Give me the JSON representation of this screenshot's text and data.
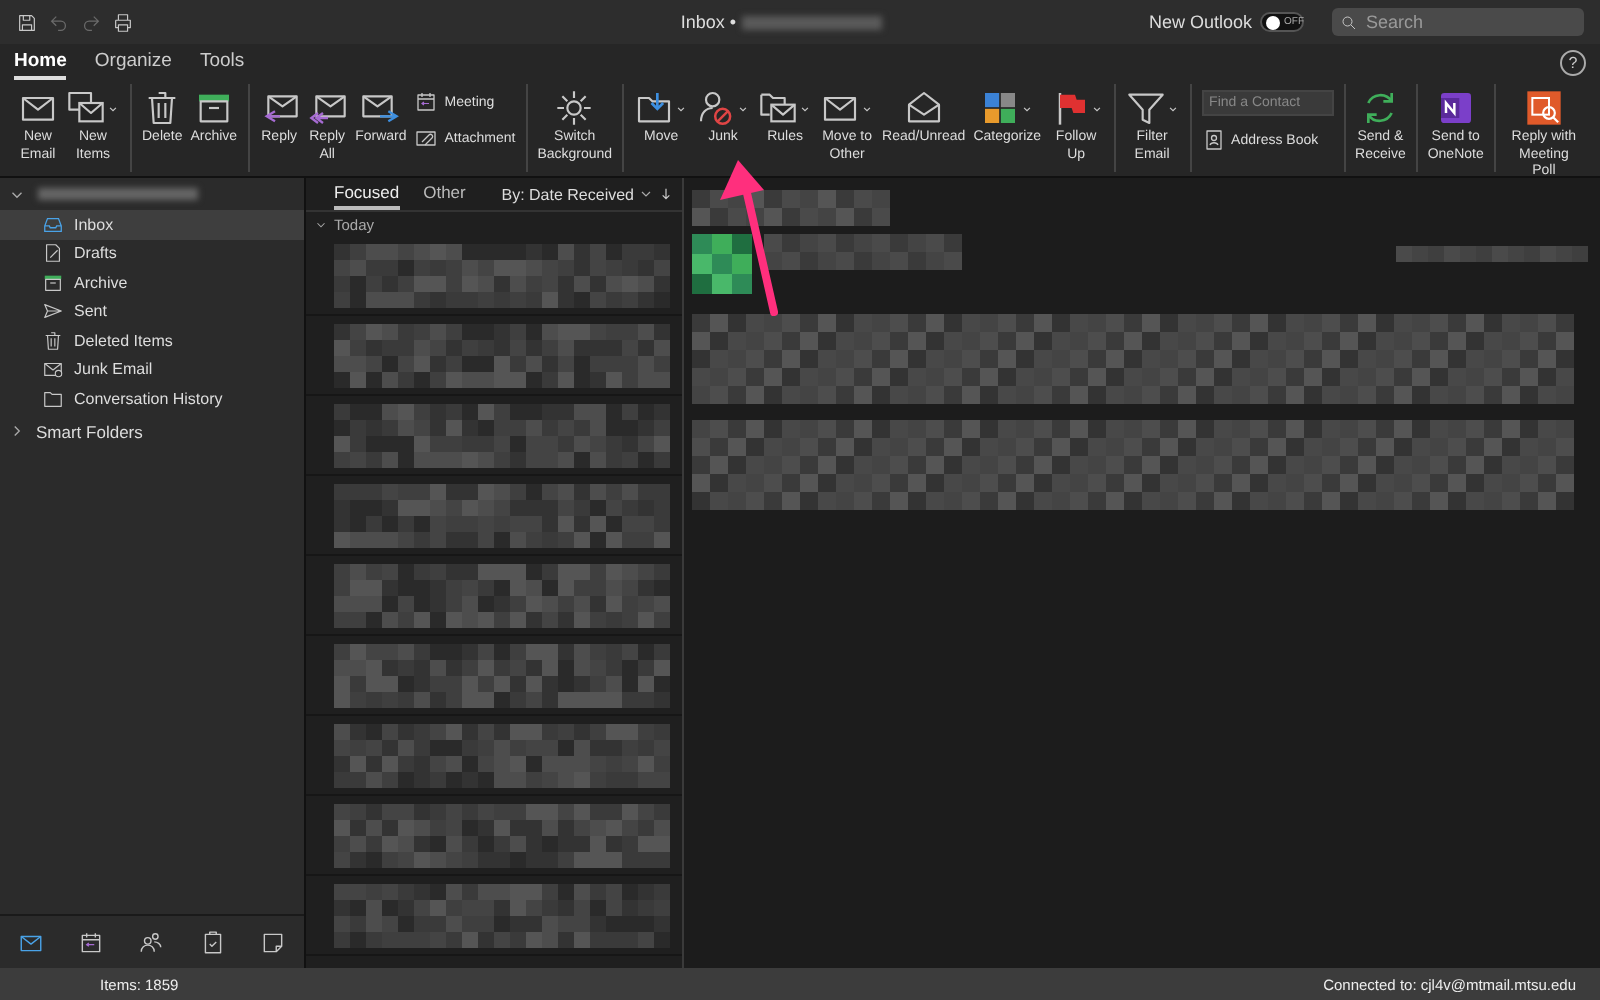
{
  "title_bar": {
    "title": "Inbox •",
    "new_outlook": {
      "label": "New Outlook",
      "on": false,
      "state_text": "OFF"
    },
    "search": {
      "placeholder": "Search"
    }
  },
  "ribbon_tabs": [
    {
      "label": "Home",
      "selected": true
    },
    {
      "label": "Organize",
      "selected": false
    },
    {
      "label": "Tools",
      "selected": false
    }
  ],
  "help": {
    "glyph": "?"
  },
  "ribbon_groups": [
    {
      "items": [
        {
          "kind": "large",
          "label": "New\nEmail",
          "dropdown": false
        },
        {
          "kind": "large",
          "label": "New\nItems",
          "dropdown": true
        }
      ]
    },
    {
      "items": [
        {
          "kind": "large",
          "label": "Delete",
          "dropdown": false
        },
        {
          "kind": "large",
          "label": "Archive",
          "dropdown": false
        }
      ]
    },
    {
      "items": [
        {
          "kind": "large",
          "label": "Reply",
          "dropdown": false
        },
        {
          "kind": "large",
          "label": "Reply\nAll",
          "dropdown": false
        },
        {
          "kind": "large",
          "label": "Forward",
          "dropdown": false
        },
        {
          "kind": "stack",
          "items": [
            {
              "kind": "small",
              "label": "Meeting"
            },
            {
              "kind": "small",
              "label": "Attachment"
            }
          ]
        }
      ]
    },
    {
      "items": [
        {
          "kind": "large",
          "label": "Switch\nBackground",
          "dropdown": false
        }
      ]
    },
    {
      "items": [
        {
          "kind": "large",
          "label": "Move",
          "dropdown": true
        },
        {
          "kind": "large",
          "label": "Junk",
          "dropdown": true
        },
        {
          "kind": "large",
          "label": "Rules",
          "dropdown": true
        },
        {
          "kind": "large",
          "label": "Move to\nOther",
          "dropdown": true
        },
        {
          "kind": "large",
          "label": "Read/Unread",
          "dropdown": false
        },
        {
          "kind": "large",
          "label": "Categorize",
          "dropdown": true
        },
        {
          "kind": "large",
          "label": "Follow\nUp",
          "dropdown": true
        }
      ]
    },
    {
      "items": [
        {
          "kind": "large",
          "label": "Filter\nEmail",
          "dropdown": true
        }
      ]
    },
    {
      "items": [
        {
          "kind": "stack",
          "items": [
            {
              "kind": "field",
              "placeholder": "Find a Contact"
            },
            {
              "kind": "small",
              "label": "Address Book"
            }
          ]
        }
      ]
    },
    {
      "items": [
        {
          "kind": "large",
          "label": "Send &\nReceive",
          "dropdown": false
        }
      ]
    },
    {
      "items": [
        {
          "kind": "large",
          "label": "Send to\nOneNote",
          "dropdown": false
        }
      ]
    },
    {
      "items": [
        {
          "kind": "large",
          "label": "Reply with\nMeeting Poll",
          "dropdown": false
        }
      ]
    }
  ],
  "sidebar": {
    "account": {
      "expanded": true
    },
    "folders": [
      {
        "label": "Inbox",
        "selected": true
      },
      {
        "label": "Drafts",
        "selected": false
      },
      {
        "label": "Archive",
        "selected": false
      },
      {
        "label": "Sent",
        "selected": false
      },
      {
        "label": "Deleted Items",
        "selected": false
      },
      {
        "label": "Junk Email",
        "selected": false
      },
      {
        "label": "Conversation History",
        "selected": false
      }
    ],
    "smart_folders": {
      "label": "Smart Folders",
      "expanded": false
    },
    "nav": [
      {
        "selected": true
      },
      {
        "selected": false
      },
      {
        "selected": false
      },
      {
        "selected": false
      },
      {
        "selected": false
      }
    ]
  },
  "message_list": {
    "tabs": [
      {
        "label": "Focused",
        "selected": true
      },
      {
        "label": "Other",
        "selected": false
      }
    ],
    "sort": "By: Date Received",
    "group": {
      "label": "Today",
      "expanded": true
    }
  },
  "status_bar": {
    "items": "Items: 1859",
    "connection": "Connected to: cjl4v@mtmail.mtsu.edu"
  }
}
